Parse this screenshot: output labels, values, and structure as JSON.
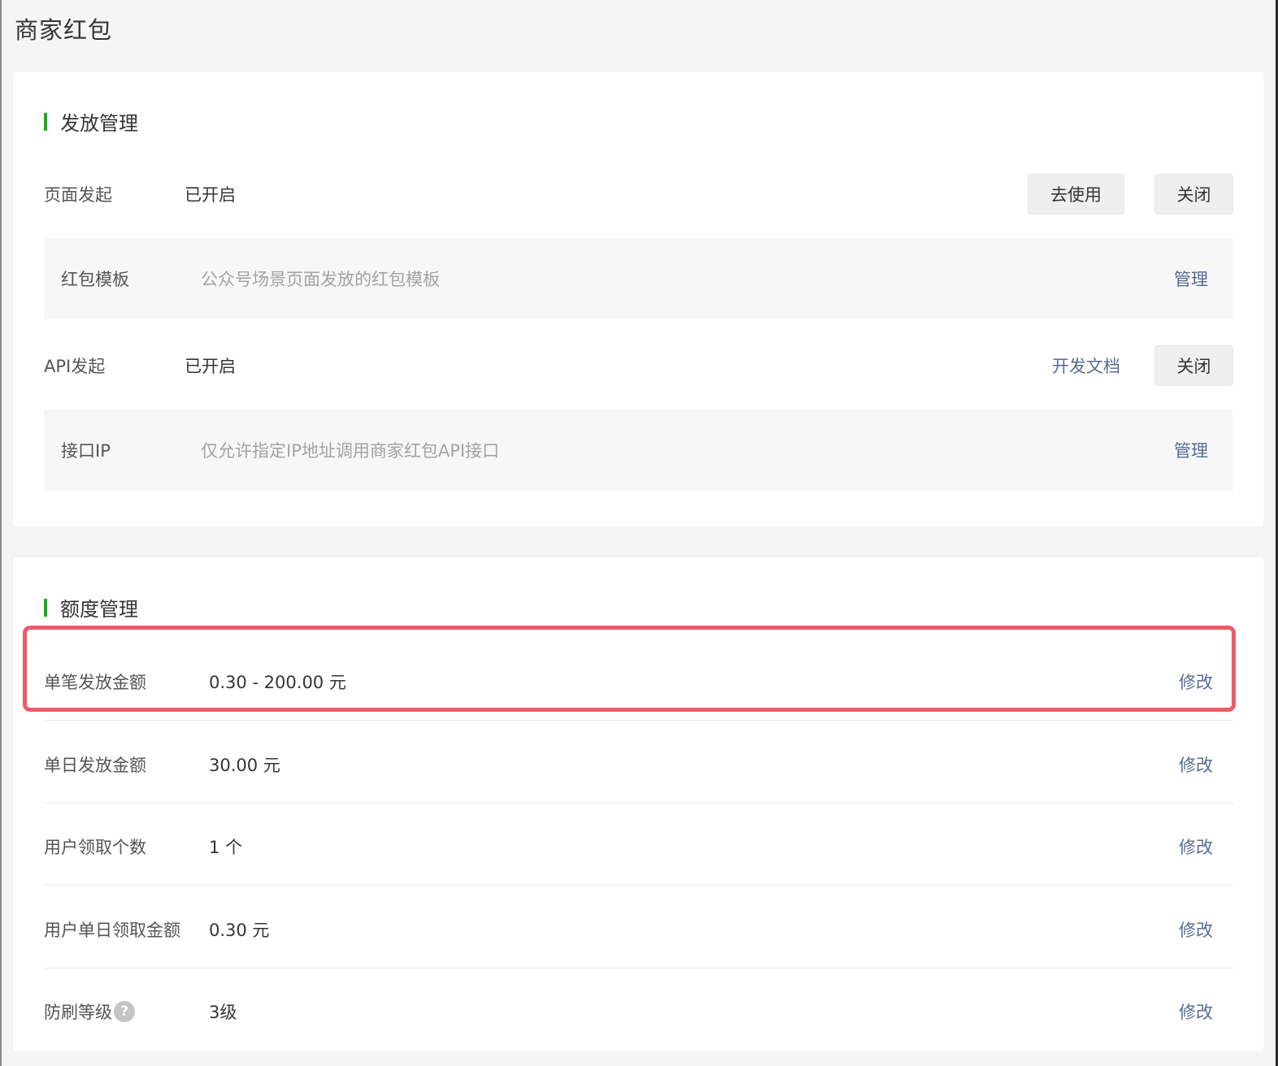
{
  "page": {
    "title": "商家红包"
  },
  "issue": {
    "section_title": "发放管理",
    "page_launch": {
      "label": "页面发起",
      "status": "已开启",
      "use_button": "去使用",
      "close_button": "关闭"
    },
    "template": {
      "label": "红包模板",
      "desc": "公众号场景页面发放的红包模板",
      "action": "管理"
    },
    "api_launch": {
      "label": "API发起",
      "status": "已开启",
      "docs_link": "开发文档",
      "close_button": "关闭"
    },
    "api_ip": {
      "label": "接口IP",
      "desc": "仅允许指定IP地址调用商家红包API接口",
      "action": "管理"
    }
  },
  "quota": {
    "section_title": "额度管理",
    "rows": [
      {
        "label": "单笔发放金额",
        "value": "0.30 - 200.00 元",
        "action": "修改"
      },
      {
        "label": "单日发放金额",
        "value": "30.00 元",
        "action": "修改"
      },
      {
        "label": "用户领取个数",
        "value": "1 个",
        "action": "修改"
      },
      {
        "label": "用户单日领取金额",
        "value": "0.30 元",
        "action": "修改"
      },
      {
        "label": "防刷等级",
        "value": "3级",
        "action": "修改",
        "help": "?"
      }
    ]
  },
  "colors": {
    "accent_green": "#1aad19",
    "link_blue": "#576b95",
    "highlight_red": "#ef5a6a"
  }
}
